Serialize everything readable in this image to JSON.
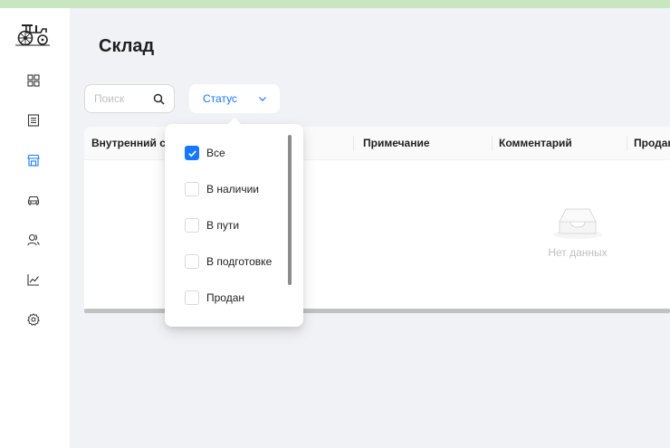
{
  "page": {
    "title": "Склад"
  },
  "colors": {
    "accent": "#1677ff",
    "topbar": "#c8e6c0",
    "sidebar_bg": "#ffffff",
    "page_bg": "#f0f2f5"
  },
  "sidebar": {
    "logo": "tractor-logo",
    "items": [
      {
        "icon": "dashboard-grid-icon",
        "active": false
      },
      {
        "icon": "list-document-icon",
        "active": false
      },
      {
        "icon": "store-icon",
        "active": true
      },
      {
        "icon": "car-icon",
        "active": false
      },
      {
        "icon": "users-icon",
        "active": false
      },
      {
        "icon": "chart-line-icon",
        "active": false
      },
      {
        "icon": "settings-gear-icon",
        "active": false
      }
    ]
  },
  "filters": {
    "search": {
      "placeholder": "Поиск",
      "value": ""
    },
    "status": {
      "label": "Статус"
    }
  },
  "table": {
    "columns": [
      "Внутренний с",
      "Примечание",
      "Комментарий",
      "Продан"
    ],
    "empty_text": "Нет данных"
  },
  "status_dropdown": {
    "options": [
      {
        "label": "Все",
        "checked": true
      },
      {
        "label": "В наличии",
        "checked": false
      },
      {
        "label": "В пути",
        "checked": false
      },
      {
        "label": "В подготовке",
        "checked": false
      },
      {
        "label": "Продан",
        "checked": false
      }
    ]
  }
}
